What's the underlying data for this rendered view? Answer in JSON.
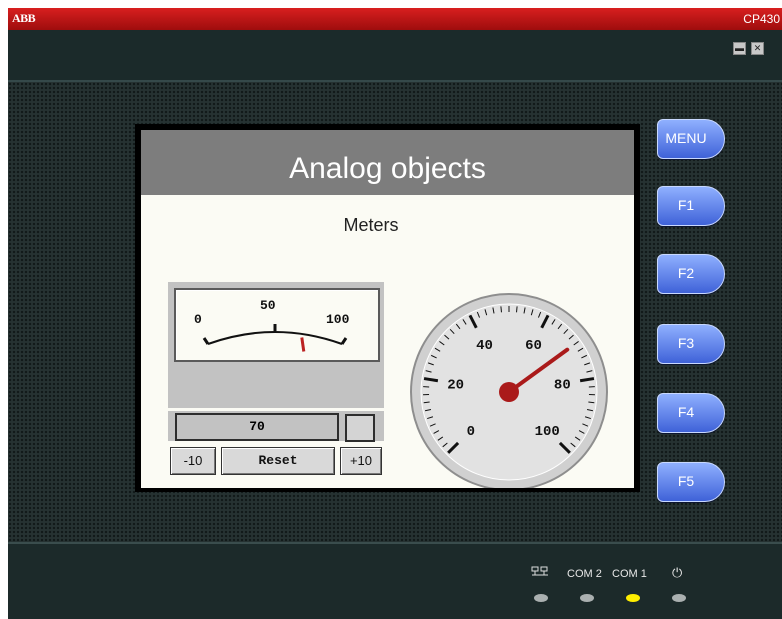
{
  "window": {
    "brand": "ABB",
    "model": "CP430",
    "minimize_glyph": "▬",
    "close_glyph": "✕"
  },
  "screen": {
    "title": "Analog objects",
    "subtitle": "Meters",
    "linear_meter": {
      "scale_labels": [
        "0",
        "50",
        "100"
      ],
      "value_fraction": 0.7
    },
    "value_display": "70",
    "buttons": {
      "minus": "-10",
      "reset": "Reset",
      "plus": "+10"
    },
    "round_gauge": {
      "scale_labels": [
        "0",
        "20",
        "40",
        "60",
        "80",
        "100"
      ],
      "value": 70
    }
  },
  "function_keys": [
    "MENU",
    "F1",
    "F2",
    "F3",
    "F4",
    "F5"
  ],
  "status": {
    "labels": [
      "COM 2",
      "COM 1"
    ],
    "network_icon": "network-icon",
    "power_icon": "power-icon",
    "power_glyph": "⏻",
    "com1_led_color": "#ffee00",
    "led_off_color": "#aab0b0"
  }
}
